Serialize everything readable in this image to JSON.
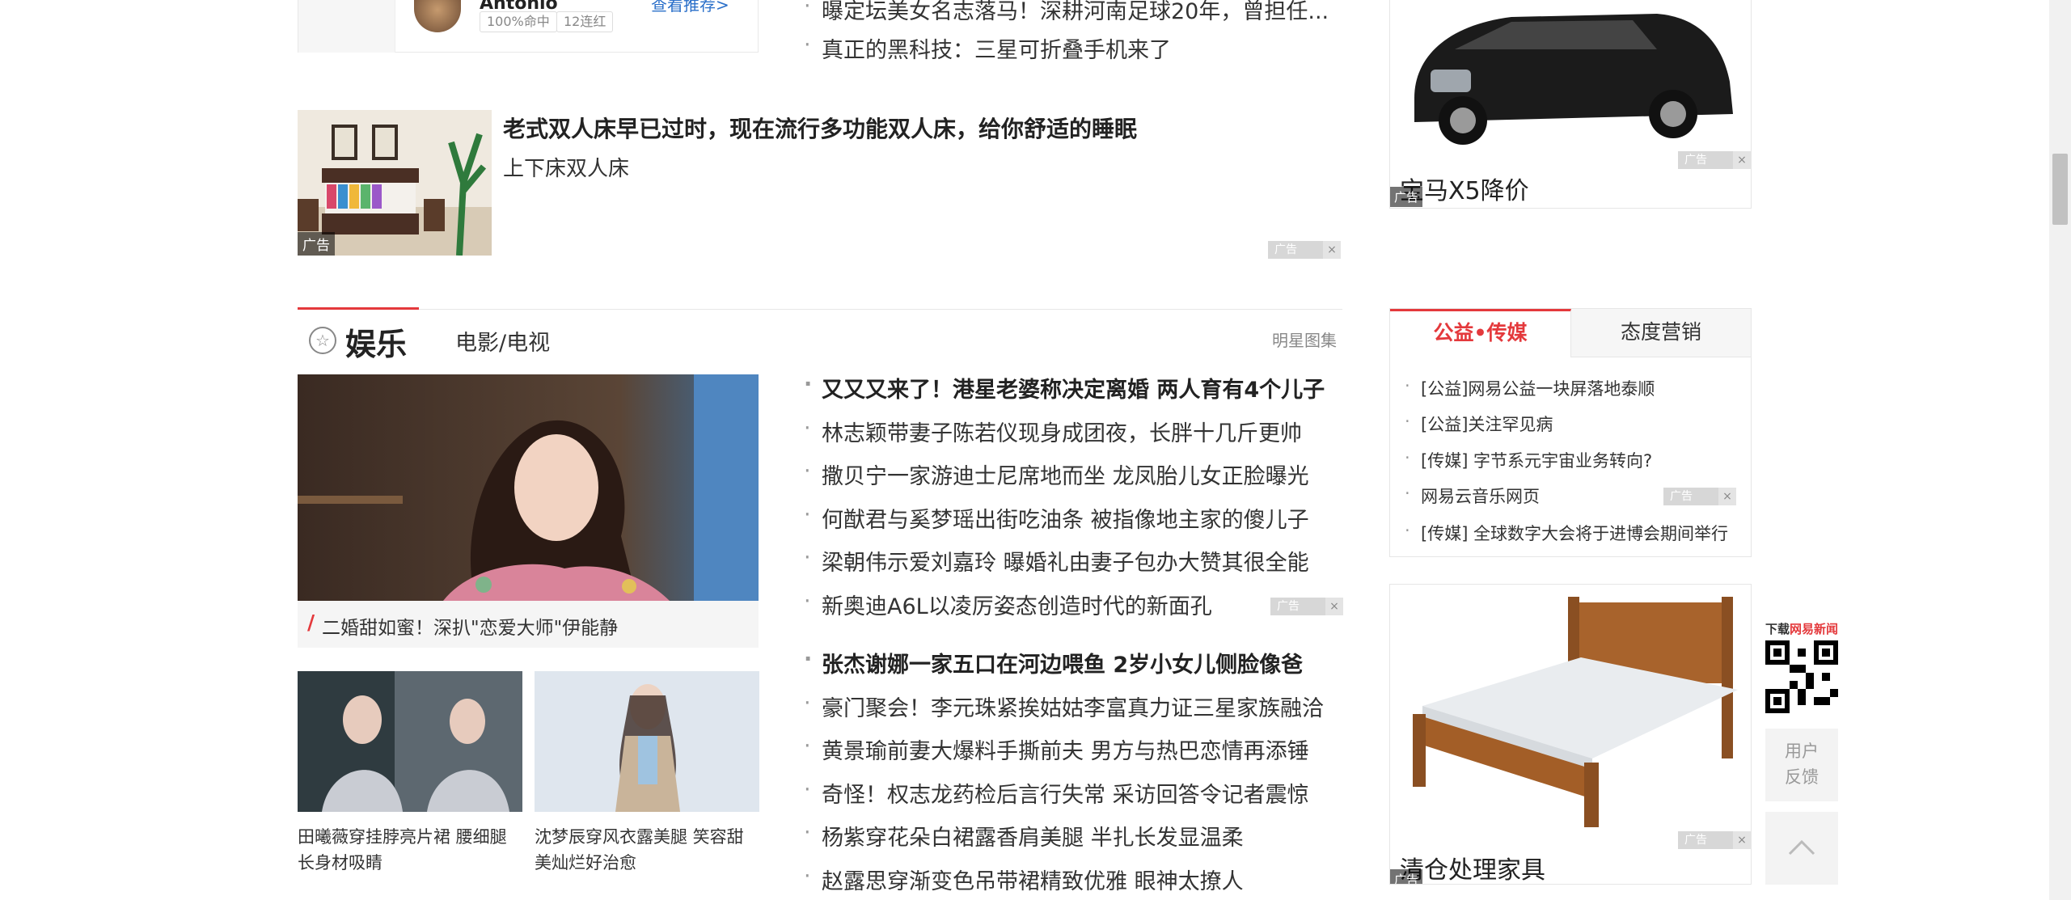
{
  "prev_card": {
    "name": "Antonio",
    "tag1": "100%命中",
    "tag2": "12连红",
    "link": "查看推荐>"
  },
  "top_news": [
    "曝定坛美女名志落马！深耕河南足球20年，曾担任...",
    "真正的黑科技：三星可折叠手机来了"
  ],
  "bed_ad": {
    "title": "老式双人床早已过时，现在流行多功能双人床，给你舒适的睡眠",
    "subtitle": "上下床双人床",
    "ad_tag": "广告",
    "ad_mark": "广告",
    "close": "×"
  },
  "section": {
    "title": "娱乐",
    "subnav": "电影/电视",
    "more": "明星图集"
  },
  "main_photo": {
    "caption": "二婚甜如蜜！深扒\"恋爱大师\"伊能静"
  },
  "thumbs": [
    {
      "caption": "田曦薇穿挂脖亮片裙 腰细腿长身材吸睛"
    },
    {
      "caption": "沈梦辰穿风衣露美腿 笑容甜美灿烂好治愈"
    }
  ],
  "news_group1": [
    "又又又来了！港星老婆称决定离婚 两人育有4个儿子",
    "林志颖带妻子陈若仪现身成团夜，长胖十几斤更帅",
    "撒贝宁一家游迪士尼席地而坐 龙凤胎儿女正脸曝光",
    "何猷君与奚梦瑶出街吃油条 被指像地主家的傻儿子",
    "梁朝伟示爱刘嘉玲 曝婚礼由妻子包办大赞其很全能",
    "新奥迪A6L以凌厉姿态创造时代的新面孔"
  ],
  "news_group2": [
    "张杰谢娜一家五口在河边喂鱼 2岁小女儿侧脸像爸",
    "豪门聚会！李元珠紧挨姑姑李富真力证三星家族融洽",
    "黄景瑜前妻大爆料手撕前夫 男方与热巴恋情再添锤",
    "奇怪！权志龙药检后言行失常 采访回答令记者震惊",
    "杨紫穿花朵白裙露香肩美腿 半扎长发显温柔",
    "赵露思穿渐变色吊带裙精致优雅 眼神太撩人"
  ],
  "car_ad": {
    "text": "宝马X5降价",
    "ad_tag": "广告",
    "ad_mark": "广告"
  },
  "public_box": {
    "tab1": "公益•传媒",
    "tab2": "态度营销",
    "items": [
      "[公益]网易公益一块屏落地泰顺",
      "[公益]关注罕见病",
      "[传媒] 字节系元宇宙业务转向?",
      "网易云音乐网页",
      "[传媒] 全球数字大会将于进博会期间举行"
    ],
    "ad_mark": "广告"
  },
  "bed2_ad": {
    "text": "清仓处理家具",
    "ad_tag": "广告",
    "ad_mark": "广告"
  },
  "side": {
    "qr_prefix": "下载",
    "qr_brand": "网易新闻",
    "feedback_1": "用户",
    "feedback_2": "反馈"
  },
  "colors": {
    "accent": "#e4393c",
    "link": "#2a6fc9"
  }
}
